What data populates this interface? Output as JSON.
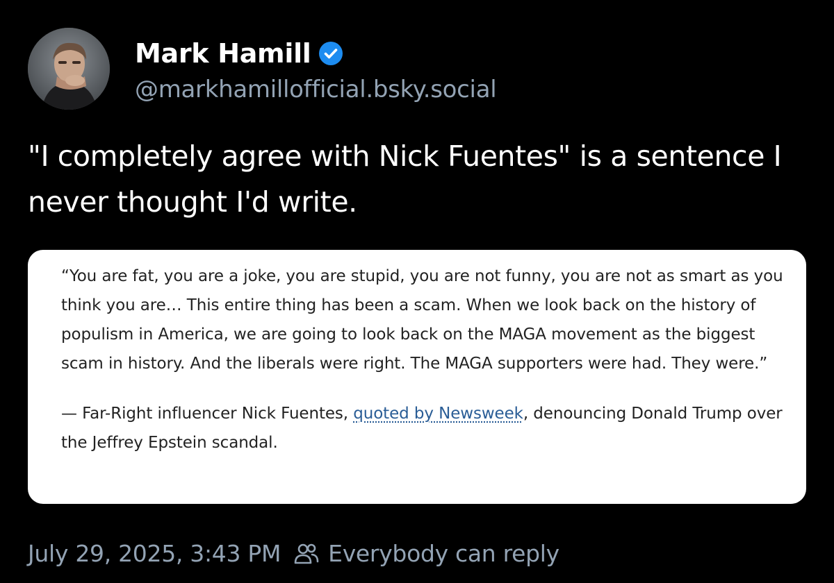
{
  "author": {
    "display_name": "Mark Hamill",
    "handle": "@markhamillofficial.bsky.social",
    "avatar_icon": "avatar",
    "verified_icon": "verified-check-icon",
    "verified_color": "#1d8cf0"
  },
  "post": {
    "text": "\"I completely agree with Nick Fuentes\" is a sentence I never thought I'd write."
  },
  "quote_card": {
    "quote": "“You are fat, you are a joke, you are stupid, you are not funny, you are not as smart as you think you are… This entire thing has been a scam. When we look back on the history of populism in America, we are going to look back on the MAGA movement as the biggest scam in history. And the liberals were right. The MAGA supporters were had. They were.”",
    "attribution_prefix": "— Far-Right influencer Nick Fuentes, ",
    "attribution_link": "quoted by Newsweek",
    "attribution_suffix": ", denouncing Donald Trump over the Jeffrey Epstein scandal.",
    "link_color": "#2a5d96"
  },
  "footer": {
    "timestamp": "July 29, 2025, 3:43 PM",
    "reply_setting": "Everybody can reply",
    "reply_icon": "people-icon",
    "muted_color": "#93a3b4"
  }
}
